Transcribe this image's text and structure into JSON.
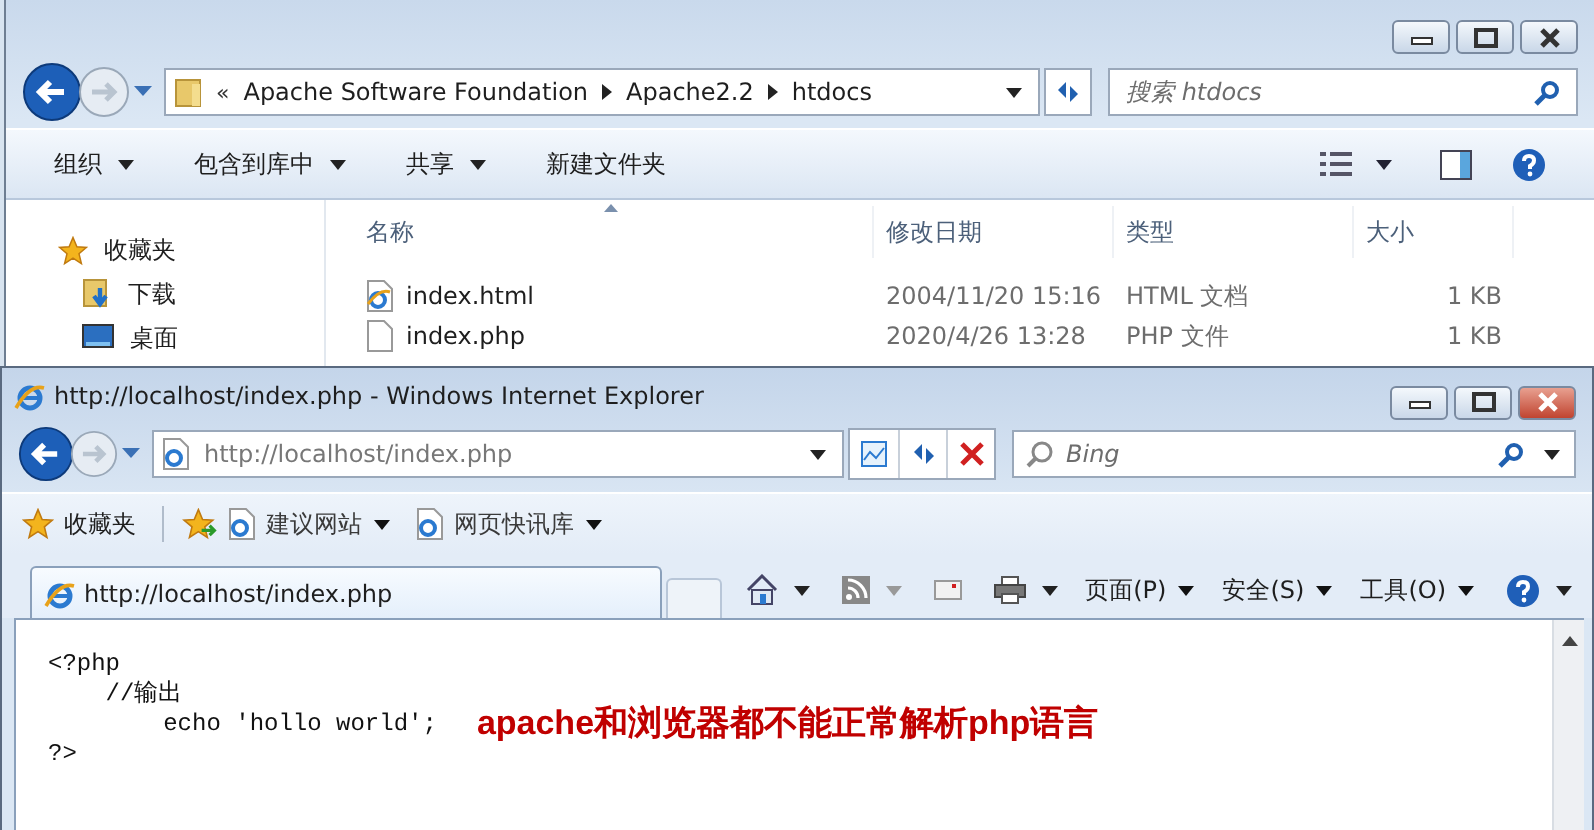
{
  "explorer": {
    "breadcrumb": {
      "overflow": "«",
      "parts": [
        "Apache Software Foundation",
        "Apache2.2",
        "htdocs"
      ]
    },
    "search": {
      "placeholder": "搜索 htdocs"
    },
    "toolbar": [
      {
        "label": "组织",
        "dropdown": true
      },
      {
        "label": "包含到库中",
        "dropdown": true
      },
      {
        "label": "共享",
        "dropdown": true
      },
      {
        "label": "新建文件夹",
        "dropdown": false
      }
    ],
    "sidebar": [
      {
        "label": "收藏夹",
        "kind": "star"
      },
      {
        "label": "下载",
        "kind": "download"
      },
      {
        "label": "桌面",
        "kind": "desktop"
      }
    ],
    "columns": [
      "名称",
      "修改日期",
      "类型",
      "大小"
    ],
    "files": [
      {
        "name": "index.html",
        "kind": "html",
        "modified": "2004/11/20 15:16",
        "type": "HTML 文档",
        "size": "1 KB"
      },
      {
        "name": "index.php",
        "kind": "file",
        "modified": "2020/4/26 13:28",
        "type": "PHP 文件",
        "size": "1 KB"
      }
    ]
  },
  "ie": {
    "title": "http://localhost/index.php - Windows Internet Explorer",
    "address": "http://localhost/index.php",
    "search": {
      "placeholder": "Bing"
    },
    "favorites": {
      "label": "收藏夹",
      "links": [
        "建议网站",
        "网页快讯库"
      ]
    },
    "tabs": [
      {
        "label": "http://localhost/index.php",
        "selected": true
      }
    ],
    "commands": [
      "页面(P)",
      "安全(S)",
      "工具(O)"
    ],
    "code_lines": [
      "<?php",
      "    //输出",
      "        echo 'hollo world';",
      "?>"
    ],
    "annotation": "apache和浏览器都不能正常解析php语言"
  }
}
